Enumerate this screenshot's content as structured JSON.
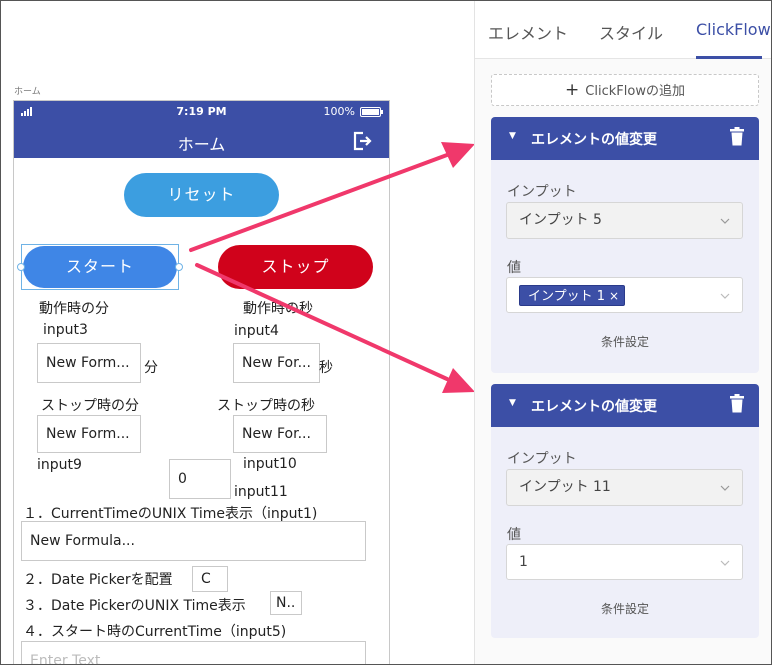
{
  "canvas": {
    "screen_label": "ホーム",
    "status_bar": {
      "time": "7:19 PM",
      "battery": "100%"
    },
    "nav_title": "ホーム",
    "buttons": {
      "reset": "リセット",
      "start": "スタート",
      "stop": "ストップ"
    },
    "labels": {
      "start_min": "動作時の分",
      "start_sec": "動作時の秒",
      "input3": "input3",
      "input4": "input4",
      "unit_min": "分",
      "unit_sec": "秒",
      "stop_min": "ストップ時の分",
      "stop_sec": "ストップ時の秒",
      "input9": "input9",
      "input10": "input10",
      "input11": "input11",
      "line1": "１．CurrentTimeのUNIX Time表示（input1)",
      "line2": "２．Date Pickerを配置",
      "line3": "３．Date PickerのUNIX Time表示",
      "line4": "４．スタート時のCurrentTime（input5)"
    },
    "fields": {
      "start_min_value": "New Form...",
      "start_sec_value": "New For...",
      "stop_min_value": "New Form...",
      "stop_sec_value": "New For...",
      "input11_value": "0",
      "formula_value": "New Formula...",
      "date_picker_value": "C",
      "unix_value": "N..",
      "enter_text_placeholder": "Enter Text"
    }
  },
  "panel": {
    "tabs": [
      "エレメント",
      "スタイル",
      "ClickFlow"
    ],
    "active_tab": "ClickFlow",
    "add_clickflow": "ClickFlowの追加",
    "cards": [
      {
        "title": "エレメントの値変更",
        "input_label": "インプット",
        "input_value": "インプット 5",
        "value_label": "値",
        "value_chip": "インプット 1",
        "condition": "条件設定"
      },
      {
        "title": "エレメントの値変更",
        "input_label": "インプット",
        "input_value": "インプット 11",
        "value_label": "値",
        "value_text": "1",
        "condition": "条件設定"
      }
    ]
  },
  "colors": {
    "primary": "#3c4fa6",
    "reset_button": "#3c9ee0",
    "start_button": "#3f86e6",
    "stop_button": "#d0021b",
    "arrow": "#f0386b",
    "card_background": "#eeeff9"
  },
  "icons": [
    "signal-icon",
    "battery-icon",
    "logout-icon",
    "plus-icon",
    "collapse-triangle-icon",
    "trash-icon",
    "chevron-down-icon",
    "remove-chip-icon"
  ]
}
